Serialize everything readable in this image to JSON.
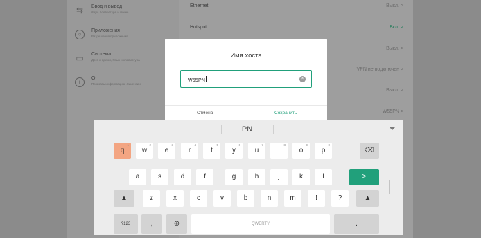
{
  "sidebar": {
    "items": [
      {
        "icon": "keyboard-icon",
        "title": "Ввод и вывод",
        "subtitle": "Звук, Клавиатура и мышь"
      },
      {
        "icon": "apps-icon",
        "title": "Приложения",
        "subtitle": "Разрешения приложений"
      },
      {
        "icon": "monitor-icon",
        "title": "Система",
        "subtitle": "Дата и время, Язык и клавиатура"
      },
      {
        "icon": "info-icon",
        "title": "О",
        "subtitle": "Показать информацию, Лицензии"
      }
    ]
  },
  "settings": {
    "rows": [
      {
        "name": "Ethernet",
        "value": "Выкл. >"
      },
      {
        "name": "Hotspot",
        "value": "Вкл. >"
      },
      {
        "name": "",
        "value": "Выкл. >"
      },
      {
        "name": "",
        "value": "VPN не подключен >"
      },
      {
        "name": "",
        "value": "Выкл. >"
      },
      {
        "name": "",
        "value": "W55PN >"
      }
    ]
  },
  "dialog": {
    "title": "Имя хоста",
    "input_value": "W55PN",
    "cancel_label": "Отмена",
    "save_label": "Сохранить"
  },
  "keyboard": {
    "suggestion": "PN",
    "row1": [
      {
        "label": "q",
        "hint": "1"
      },
      {
        "label": "w",
        "hint": "2"
      },
      {
        "label": "e",
        "hint": "3"
      },
      {
        "label": "r",
        "hint": "4"
      },
      {
        "label": "t",
        "hint": "5"
      },
      {
        "label": "y",
        "hint": "6"
      },
      {
        "label": "u",
        "hint": "7"
      },
      {
        "label": "i",
        "hint": "8"
      },
      {
        "label": "o",
        "hint": "9"
      },
      {
        "label": "p",
        "hint": "0"
      }
    ],
    "backspace_label": "⌫",
    "row2": [
      "a",
      "s",
      "d",
      "f",
      "g",
      "h",
      "j",
      "k",
      "l"
    ],
    "enter_label": ">",
    "shift_label": "▲",
    "row3": [
      "z",
      "x",
      "c",
      "v",
      "b",
      "n",
      "m",
      "!",
      "?"
    ],
    "symbols_label": "?123",
    "comma_label": ",",
    "globe_label": "⊕",
    "space_label": "QWERTY",
    "period_label": "."
  },
  "colors": {
    "accent": "#21a07b",
    "highlight_key": "#f3a582"
  }
}
